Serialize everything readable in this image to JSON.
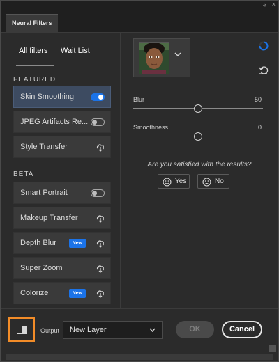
{
  "panel": {
    "tab_title": "Neural Filters",
    "collapse_glyph": "«",
    "close_glyph": "×"
  },
  "sidebar": {
    "tabs": [
      {
        "label": "All filters",
        "active": true
      },
      {
        "label": "Wait List",
        "active": false
      }
    ],
    "sections": [
      {
        "label": "FEATURED",
        "items": [
          {
            "label": "Skin Smoothing",
            "control": "toggle",
            "state": "on",
            "selected": true
          },
          {
            "label": "JPEG Artifacts Re...",
            "control": "toggle",
            "state": "off",
            "selected": false
          },
          {
            "label": "Style Transfer",
            "control": "cloud-download-icon",
            "selected": false
          }
        ]
      },
      {
        "label": "BETA",
        "items": [
          {
            "label": "Smart Portrait",
            "control": "toggle",
            "state": "off"
          },
          {
            "label": "Makeup Transfer",
            "control": "cloud-download-icon"
          },
          {
            "label": "Depth Blur",
            "control": "cloud-download-icon",
            "badge": "New"
          },
          {
            "label": "Super Zoom",
            "control": "cloud-download-icon"
          },
          {
            "label": "Colorize",
            "control": "cloud-download-icon",
            "badge": "New"
          }
        ]
      }
    ]
  },
  "main": {
    "preview_selector": {
      "icon": "chevron-down-icon"
    },
    "sliders": [
      {
        "label": "Blur",
        "value": "50",
        "fraction": 0.5
      },
      {
        "label": "Smoothness",
        "value": "0",
        "fraction": 0.5
      }
    ],
    "feedback": {
      "question": "Are you satisfied with the results?",
      "yes_label": "Yes",
      "no_label": "No"
    }
  },
  "footer": {
    "output_label": "Output",
    "output_value": "New Layer",
    "ok_label": "OK",
    "cancel_label": "Cancel"
  },
  "colors": {
    "accent": "#1b73e8",
    "highlight": "#f28c28",
    "panel_bg": "#2b2b2b",
    "selected_bg": "#3d4b61"
  }
}
